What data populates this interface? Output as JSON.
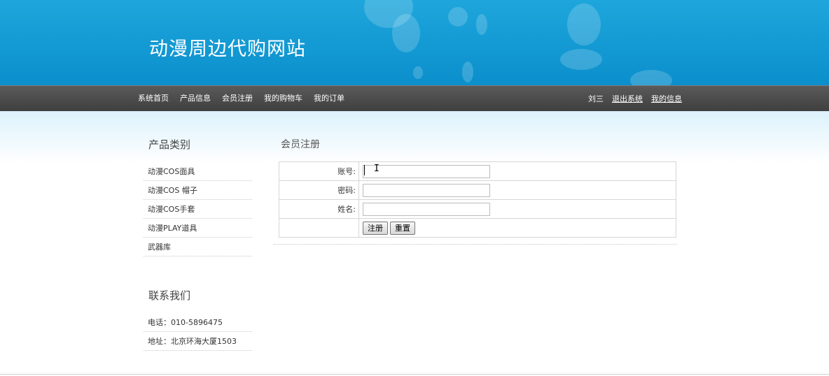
{
  "site": {
    "title": "动漫周边代购网站"
  },
  "nav": {
    "items": [
      {
        "label": "系统首页"
      },
      {
        "label": "产品信息"
      },
      {
        "label": "会员注册"
      },
      {
        "label": "我的购物车"
      },
      {
        "label": "我的订单"
      }
    ],
    "user": {
      "name": "刘三",
      "logout": "退出系统",
      "my_info": "我的信息"
    }
  },
  "sidebar": {
    "category_title": "产品类别",
    "categories": [
      {
        "label": "动漫COS面具"
      },
      {
        "label": "动漫COS 帽子"
      },
      {
        "label": "动漫COS手套"
      },
      {
        "label": "动漫PLAY道具"
      },
      {
        "label": "武器库"
      }
    ],
    "contact_title": "联系我们",
    "contact": [
      {
        "label": "电话：",
        "value": "010-5896475"
      },
      {
        "label": "地址：",
        "value": "北京环海大厦1503"
      }
    ]
  },
  "main": {
    "title": "会员注册",
    "form": {
      "account_label": "账号:",
      "account_value": "",
      "password_label": "密码:",
      "password_value": "",
      "name_label": "姓名:",
      "name_value": "",
      "register_button": "注册",
      "reset_button": "重置"
    }
  },
  "colors": {
    "header_blue": "#0b8fcc",
    "nav_gray": "#4a4a4a",
    "band_light": "#dcf2fc"
  }
}
